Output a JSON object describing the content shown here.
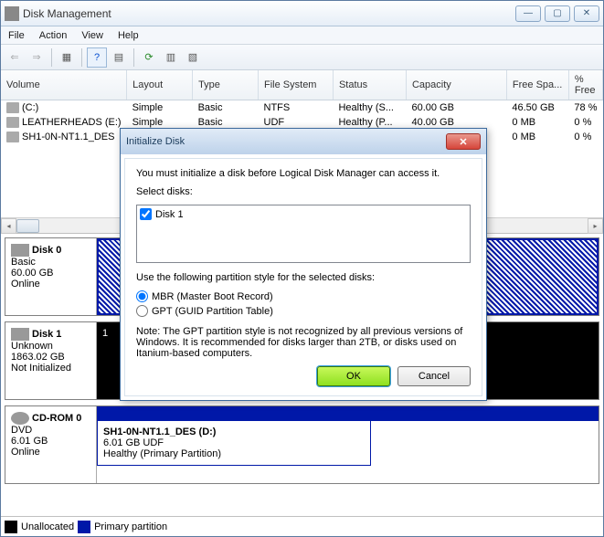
{
  "window": {
    "title": "Disk Management"
  },
  "menu": {
    "file": "File",
    "action": "Action",
    "view": "View",
    "help": "Help"
  },
  "columns": {
    "volume": "Volume",
    "layout": "Layout",
    "type": "Type",
    "fs": "File System",
    "status": "Status",
    "capacity": "Capacity",
    "free": "Free Spa...",
    "pctfree": "% Free"
  },
  "rows": [
    {
      "volume": "(C:)",
      "layout": "Simple",
      "type": "Basic",
      "fs": "NTFS",
      "status": "Healthy (S...",
      "capacity": "60.00 GB",
      "free": "46.50 GB",
      "pctfree": "78 %"
    },
    {
      "volume": "LEATHERHEADS (E:)",
      "layout": "Simple",
      "type": "Basic",
      "fs": "UDF",
      "status": "Healthy (P...",
      "capacity": "40.00 GB",
      "free": "0 MB",
      "pctfree": "0 %"
    },
    {
      "volume": "SH1-0N-NT1.1_DES",
      "layout": "",
      "type": "",
      "fs": "",
      "status": "",
      "capacity": "",
      "free": "0 MB",
      "pctfree": "0 %"
    }
  ],
  "disks": {
    "d0": {
      "name": "Disk 0",
      "type": "Basic",
      "size": "60.00 GB",
      "state": "Online"
    },
    "d1": {
      "name": "Disk 1",
      "type": "Unknown",
      "size": "1863.02 GB",
      "state": "Not Initialized",
      "vol": "1"
    },
    "cd": {
      "name": "CD-ROM 0",
      "type": "DVD",
      "size": "6.01 GB",
      "state": "Online",
      "vlabel": "SH1-0N-NT1.1_DES  (D:)",
      "vsize": "6.01 GB UDF",
      "vstatus": "Healthy (Primary Partition)"
    }
  },
  "legend": {
    "unalloc": "Unallocated",
    "primary": "Primary partition"
  },
  "dialog": {
    "title": "Initialize Disk",
    "msg": "You must initialize a disk before Logical Disk Manager can access it.",
    "select": "Select disks:",
    "disk1": "Disk 1",
    "partstyle": "Use the following partition style for the selected disks:",
    "mbr": "MBR (Master Boot Record)",
    "gpt": "GPT (GUID Partition Table)",
    "note": "Note: The GPT partition style is not recognized by all previous versions of Windows. It is recommended for disks larger than 2TB, or disks used on Itanium-based computers.",
    "ok": "OK",
    "cancel": "Cancel"
  }
}
